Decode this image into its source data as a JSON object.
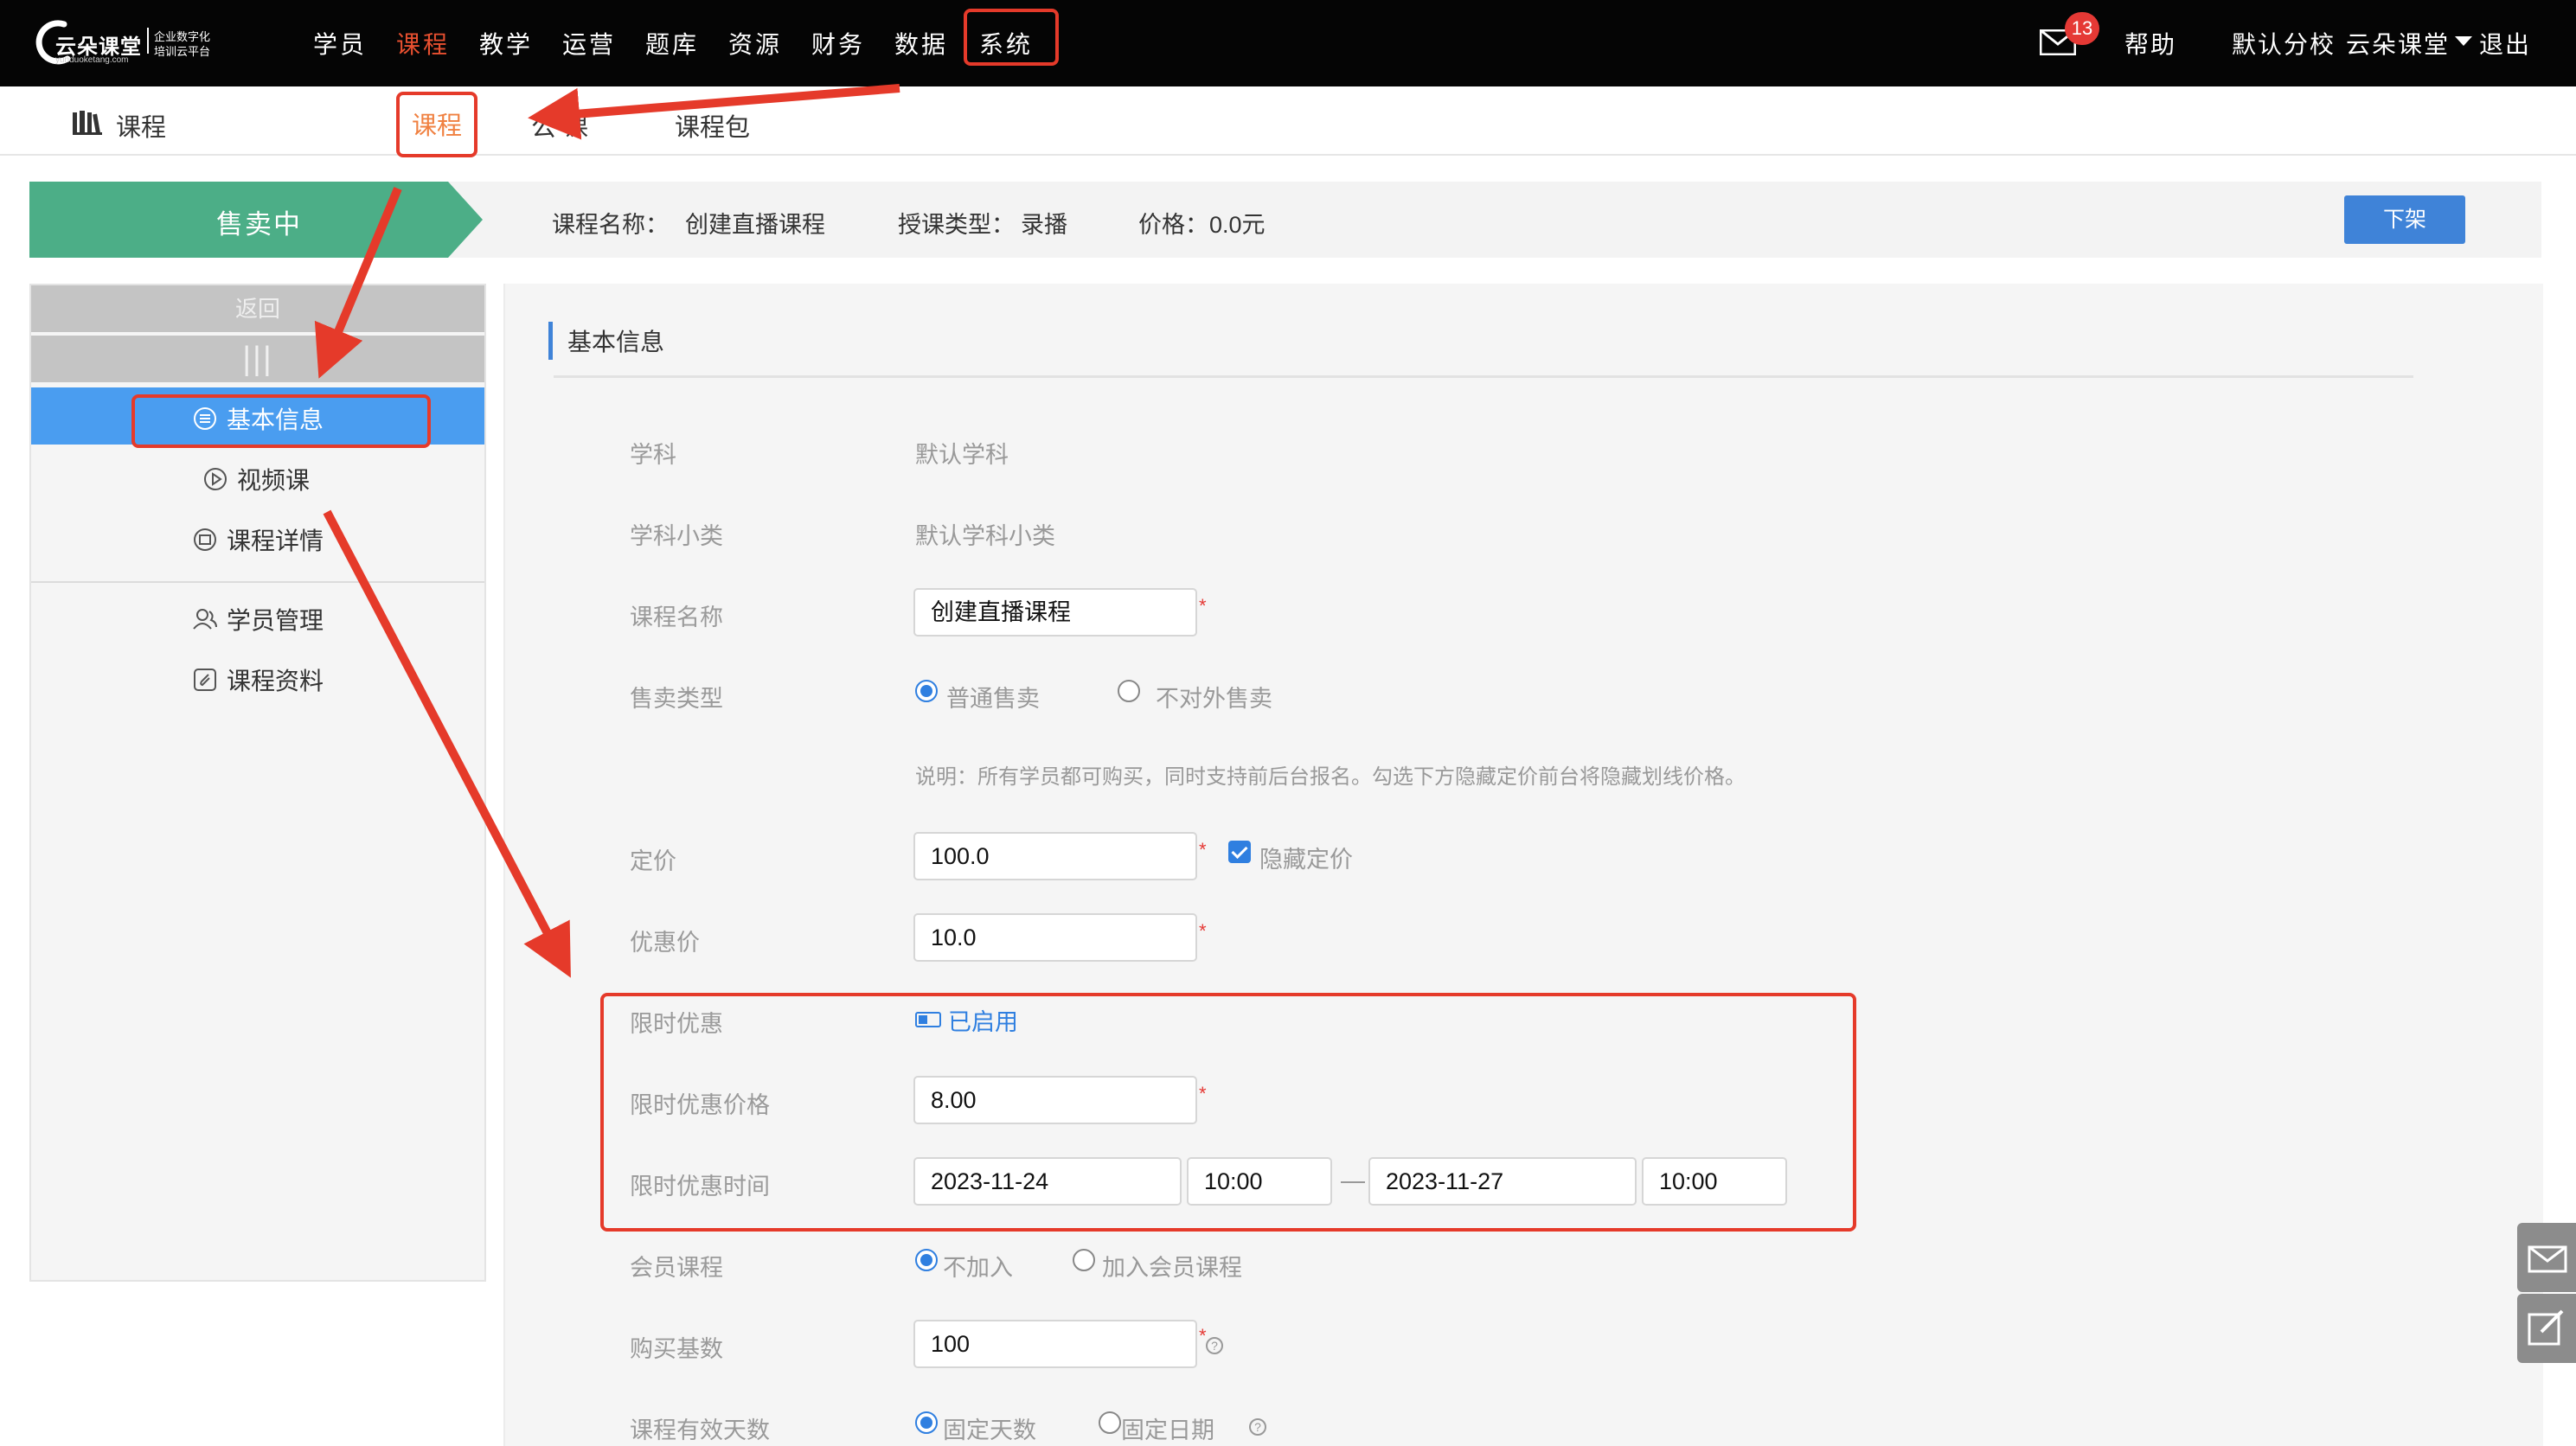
{
  "colors": {
    "topbar_bg": "#050505",
    "active_nav": "#e85030",
    "accent_blue": "#3f83d8",
    "selling_green": "#4cae87",
    "annotation_red": "#e53a2a"
  },
  "logo": {
    "brand": "云朵课堂",
    "tagline_line1": "企业数字化",
    "tagline_line2": "培训云平台",
    "url": "yunduoketang.com"
  },
  "topnav": {
    "items": [
      "学员",
      "课程",
      "教学",
      "运营",
      "题库",
      "资源",
      "财务",
      "数据",
      "系统"
    ],
    "active": "课程",
    "mail_icon": "mail-icon",
    "mail_count": "13",
    "help": "帮助",
    "campus": "默认分校",
    "user": "云朵课堂",
    "logout": "退出"
  },
  "subheader": {
    "icon": "books-icon",
    "title": "课程",
    "tabs": [
      "课程",
      "公开课",
      "课程包"
    ],
    "active_tab": "课程",
    "visible_tab2_text": "公    课"
  },
  "status": {
    "state": "售卖中",
    "course_name_label": "课程名称：",
    "course_name": "创建直播课程",
    "teach_type_label": "授课类型：",
    "teach_type": "录播",
    "price_label": "价格：",
    "price": "0.0元",
    "offshelf_button": "下架"
  },
  "leftmenu": {
    "back": "返回",
    "grip": "|||",
    "items": [
      {
        "label": "基本信息",
        "icon": "list-circle-icon",
        "active": true
      },
      {
        "label": "视频课",
        "icon": "play-circle-icon",
        "active": false
      },
      {
        "label": "课程详情",
        "icon": "details-icon",
        "active": false
      },
      {
        "label": "学员管理",
        "icon": "users-icon",
        "active": false
      },
      {
        "label": "课程资料",
        "icon": "attachment-icon",
        "active": false
      }
    ]
  },
  "form": {
    "section_title": "基本信息",
    "subject_label": "学科",
    "subject_value": "默认学科",
    "subcategory_label": "学科小类",
    "subcategory_value": "默认学科小类",
    "course_name_label": "课程名称",
    "course_name_value": "创建直播课程",
    "sale_type_label": "售卖类型",
    "sale_type_options": [
      "普通售卖",
      "不对外售卖"
    ],
    "sale_type_selected": "普通售卖",
    "sale_note": "说明：所有学员都可购买，同时支持前后台报名。勾选下方隐藏定价前台将隐藏划线价格。",
    "list_price_label": "定价",
    "list_price_value": "100.0",
    "hide_price_label": "隐藏定价",
    "hide_price_checked": true,
    "discount_label": "优惠价",
    "discount_value": "10.0",
    "limited_label": "限时优惠",
    "limited_status": "已启用",
    "limited_price_label": "限时优惠价格",
    "limited_price_value": "8.00",
    "limited_time_label": "限时优惠时间",
    "start_date": "2023-11-24",
    "start_time": "10:00",
    "end_date": "2023-11-27",
    "end_time": "10:00",
    "member_label": "会员课程",
    "member_options": [
      "不加入",
      "加入会员课程"
    ],
    "member_selected": "不加入",
    "base_count_label": "购买基数",
    "base_count_value": "100",
    "validity_label": "课程有效天数",
    "validity_options": [
      "固定天数",
      "固定日期"
    ],
    "validity_selected": "固定天数",
    "required_mark": "*",
    "help_mark": "?"
  },
  "floating_tools": [
    "envelope-icon",
    "edit-icon"
  ]
}
